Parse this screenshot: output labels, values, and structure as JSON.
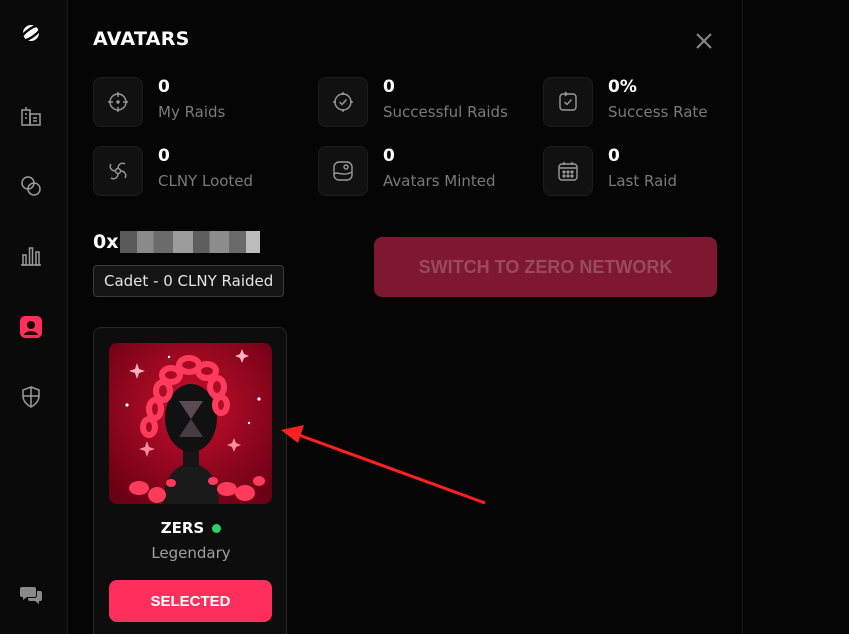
{
  "panel": {
    "title": "AVATARS"
  },
  "stats": [
    {
      "value": "0",
      "label": "My Raids",
      "icon": "crosshair-icon"
    },
    {
      "value": "0",
      "label": "Successful Raids",
      "icon": "check-target-icon"
    },
    {
      "value": "0%",
      "label": "Success Rate",
      "icon": "refresh-check-icon"
    },
    {
      "value": "0",
      "label": "CLNY Looted",
      "icon": "vortex-icon"
    },
    {
      "value": "0",
      "label": "Avatars Minted",
      "icon": "avatar-frame-icon"
    },
    {
      "value": "0",
      "label": "Last Raid",
      "icon": "calendar-icon"
    }
  ],
  "profile": {
    "username_prefix": "0x",
    "rank": "Cadet - 0 CLNY Raided"
  },
  "network": {
    "switch_label": "SWITCH TO ZERO NETWORK"
  },
  "avatar": {
    "name": "ZERS",
    "rarity": "Legendary",
    "status": "online",
    "button_label": "SELECTED"
  },
  "colors": {
    "accent": "#ff2e5b",
    "switch_button_bg": "#7d1830",
    "online": "#25d366"
  }
}
